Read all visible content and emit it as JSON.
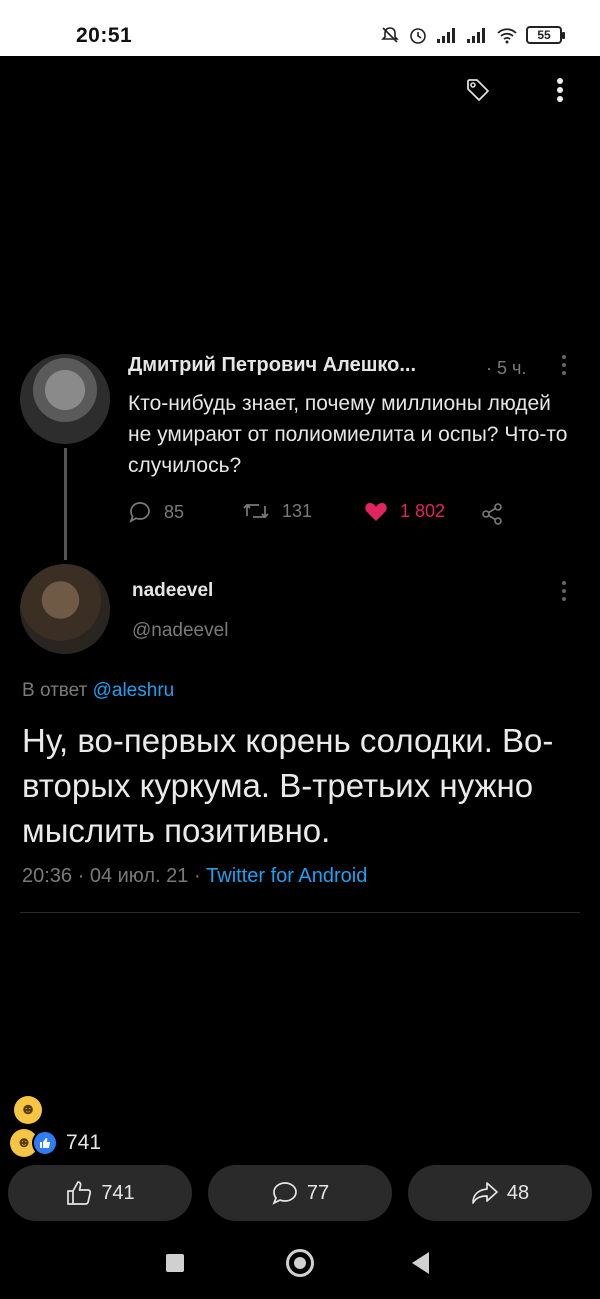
{
  "status_bar": {
    "time": "20:51",
    "battery": "55",
    "icons": [
      "mute-icon",
      "alarm-icon",
      "signal-icon",
      "signal-icon",
      "wifi-icon",
      "battery-icon"
    ]
  },
  "top_actions": {
    "icons": [
      "tag-icon",
      "more-vertical-icon"
    ]
  },
  "tweet": {
    "original": {
      "author": "Дмитрий Петрович Алешко...",
      "time": "· 5 ч.",
      "text": "Кто-нибудь знает, почему миллионы людей не умирают от полиомиелита и оспы? Что-то случилось?",
      "replies": "85",
      "retweets": "131",
      "likes": "1 802"
    },
    "reply": {
      "name": "nadeevel",
      "handle": "@nadeevel",
      "reply_to_prefix": "В ответ",
      "reply_to_mention": "@aleshru",
      "text": "Ну, во-первых корень солодки. Во-вторых куркума. В-третьих нужно мыслить позитивно.",
      "meta_time": "20:36 · 04 июл. 21 · ",
      "meta_source": "Twitter for Android"
    }
  },
  "post": {
    "reaction_count": "741",
    "buttons": {
      "like": "741",
      "comment": "77",
      "share": "48"
    }
  },
  "colors": {
    "background": "#000000",
    "link": "#1da1f2",
    "like": "#e0245e",
    "muted": "#7a7a7a",
    "pill": "#2a2a2a"
  }
}
